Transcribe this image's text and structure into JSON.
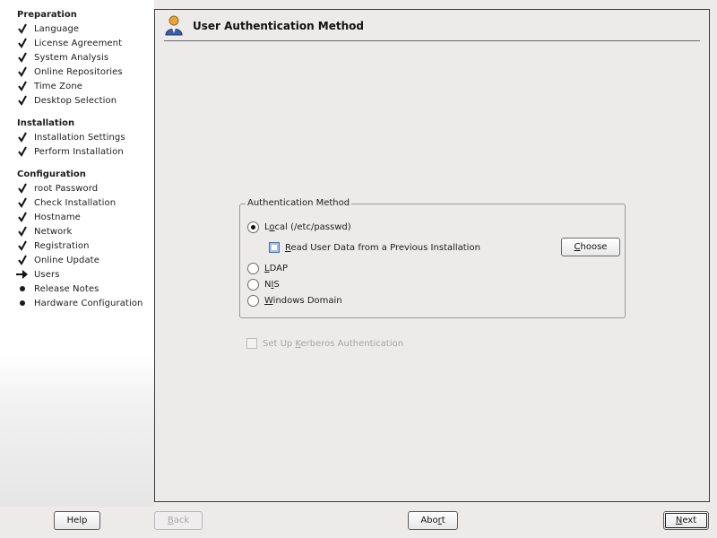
{
  "sidebar": {
    "sections": [
      {
        "title": "Preparation",
        "steps": [
          {
            "label": "Language",
            "state": "done"
          },
          {
            "label": "License Agreement",
            "state": "done"
          },
          {
            "label": "System Analysis",
            "state": "done"
          },
          {
            "label": "Online Repositories",
            "state": "done"
          },
          {
            "label": "Time Zone",
            "state": "done"
          },
          {
            "label": "Desktop Selection",
            "state": "done"
          }
        ]
      },
      {
        "title": "Installation",
        "steps": [
          {
            "label": "Installation Settings",
            "state": "done"
          },
          {
            "label": "Perform Installation",
            "state": "done"
          }
        ]
      },
      {
        "title": "Configuration",
        "steps": [
          {
            "label": "root Password",
            "state": "done"
          },
          {
            "label": "Check Installation",
            "state": "done"
          },
          {
            "label": "Hostname",
            "state": "done"
          },
          {
            "label": "Network",
            "state": "done"
          },
          {
            "label": "Registration",
            "state": "done"
          },
          {
            "label": "Online Update",
            "state": "done"
          },
          {
            "label": "Users",
            "state": "current"
          },
          {
            "label": "Release Notes",
            "state": "pending"
          },
          {
            "label": "Hardware Configuration",
            "state": "pending"
          }
        ]
      }
    ]
  },
  "header": {
    "title": "User Authentication Method",
    "icon": "user-icon"
  },
  "auth": {
    "group_title": "Authentication Method",
    "local": {
      "before": "L",
      "key": "o",
      "after": "cal (/etc/passwd)",
      "selected": true
    },
    "read_data": {
      "key": "R",
      "after": "ead User Data from a Previous Installation",
      "checked": false
    },
    "choose_button": {
      "key": "C",
      "after": "hoose"
    },
    "ldap": {
      "key": "L",
      "after": "DAP",
      "selected": false
    },
    "nis": {
      "before": "N",
      "key": "I",
      "after": "S",
      "selected": false
    },
    "windows": {
      "key": "W",
      "after": "indows Domain",
      "selected": false
    }
  },
  "kerberos": {
    "before": "Set Up ",
    "key": "K",
    "after": "erberos Authentication",
    "enabled": false,
    "checked": false
  },
  "buttons": {
    "help": "Help",
    "back": {
      "key": "B",
      "after": "ack"
    },
    "abort": {
      "before": "Abo",
      "key": "r",
      "after": "t"
    },
    "next": {
      "key": "N",
      "after": "ext"
    }
  },
  "colors": {
    "background": "#edeaea",
    "sidebar": "#ffffff",
    "border": "#3a3a3a"
  }
}
